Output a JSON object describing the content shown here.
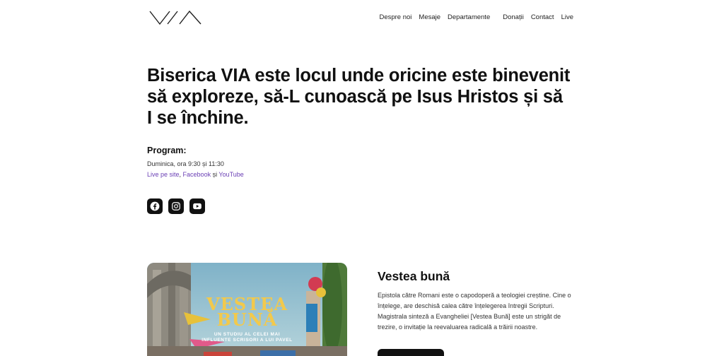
{
  "header": {
    "logo_alt": "VIA",
    "nav": [
      {
        "label": "Despre noi"
      },
      {
        "label": "Mesaje"
      },
      {
        "label": "Departamente"
      },
      {
        "label": "Donații"
      },
      {
        "label": "Contact"
      },
      {
        "label": "Live"
      }
    ]
  },
  "hero": {
    "title": "Biserica VIA este locul unde oricine este binevenit să exploreze, să-L cunoască pe Isus Hristos și să I se închine."
  },
  "program": {
    "label": "Program:",
    "time": "Duminica, ora 9:30 și 11:30",
    "link_site": "Live pe site",
    "sep1": ", ",
    "link_facebook": "Facebook",
    "sep2": " și ",
    "link_youtube": "YouTube"
  },
  "socials": [
    {
      "icon": "facebook-icon"
    },
    {
      "icon": "instagram-icon"
    },
    {
      "icon": "youtube-icon"
    }
  ],
  "feature": {
    "poster_title_1": "VESTEA",
    "poster_title_2": "BUNĂ",
    "poster_sub_1": "UN STUDIU AL CELEI MAI",
    "poster_sub_2": "INFLUENTE SCRISORI A LUI PAVEL",
    "title": "Vestea bună",
    "text": "Epistola către Romani este o capodoperă a teologiei creștine. Cine o înțelege, are deschisă calea către înțelegerea întregii Scripturi. Magistrala sinteză a Evangheliei [Vestea Bună] este un strigăt de trezire, o invitație la reevaluarea radicală a trăirii noastre."
  },
  "colors": {
    "accent_link": "#6a3fb5",
    "dark": "#111111"
  }
}
